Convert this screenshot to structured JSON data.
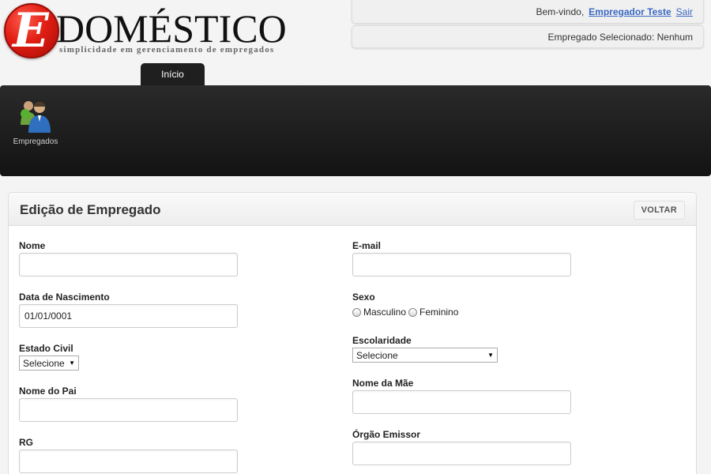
{
  "logo": {
    "letter": "E",
    "word": "DOMÉSTICO",
    "tagline": "simplicidade em gerenciamento de empregados"
  },
  "header": {
    "welcome": "Bem-vindo,",
    "user_link": "Empregador Teste",
    "logout_link": "Sair",
    "selected_employee": "Empregado Selecionado: Nenhum"
  },
  "nav": {
    "tab_home": "Início",
    "tool_employees": "Empregados"
  },
  "panel": {
    "title": "Edição de Empregado",
    "back_button": "VOLTAR"
  },
  "form": {
    "nome": {
      "label": "Nome",
      "value": ""
    },
    "email": {
      "label": "E-mail",
      "value": ""
    },
    "data_nascimento": {
      "label": "Data de Nascimento",
      "value": "01/01/0001"
    },
    "sexo": {
      "label": "Sexo",
      "option_m": "Masculino",
      "option_f": "Feminino"
    },
    "estado_civil": {
      "label": "Estado Civil",
      "value": "Selecione"
    },
    "escolaridade": {
      "label": "Escolaridade",
      "value": "Selecione"
    },
    "nome_pai": {
      "label": "Nome do Pai",
      "value": ""
    },
    "nome_mae": {
      "label": "Nome da Mãe",
      "value": ""
    },
    "rg": {
      "label": "RG",
      "value": ""
    },
    "orgao_emissor": {
      "label": "Órgão Emissor",
      "value": ""
    }
  },
  "colors": {
    "logo_red": "#e01e14",
    "link_blue": "#3a68c2",
    "toolbar_dark": "#1b1b1b"
  }
}
